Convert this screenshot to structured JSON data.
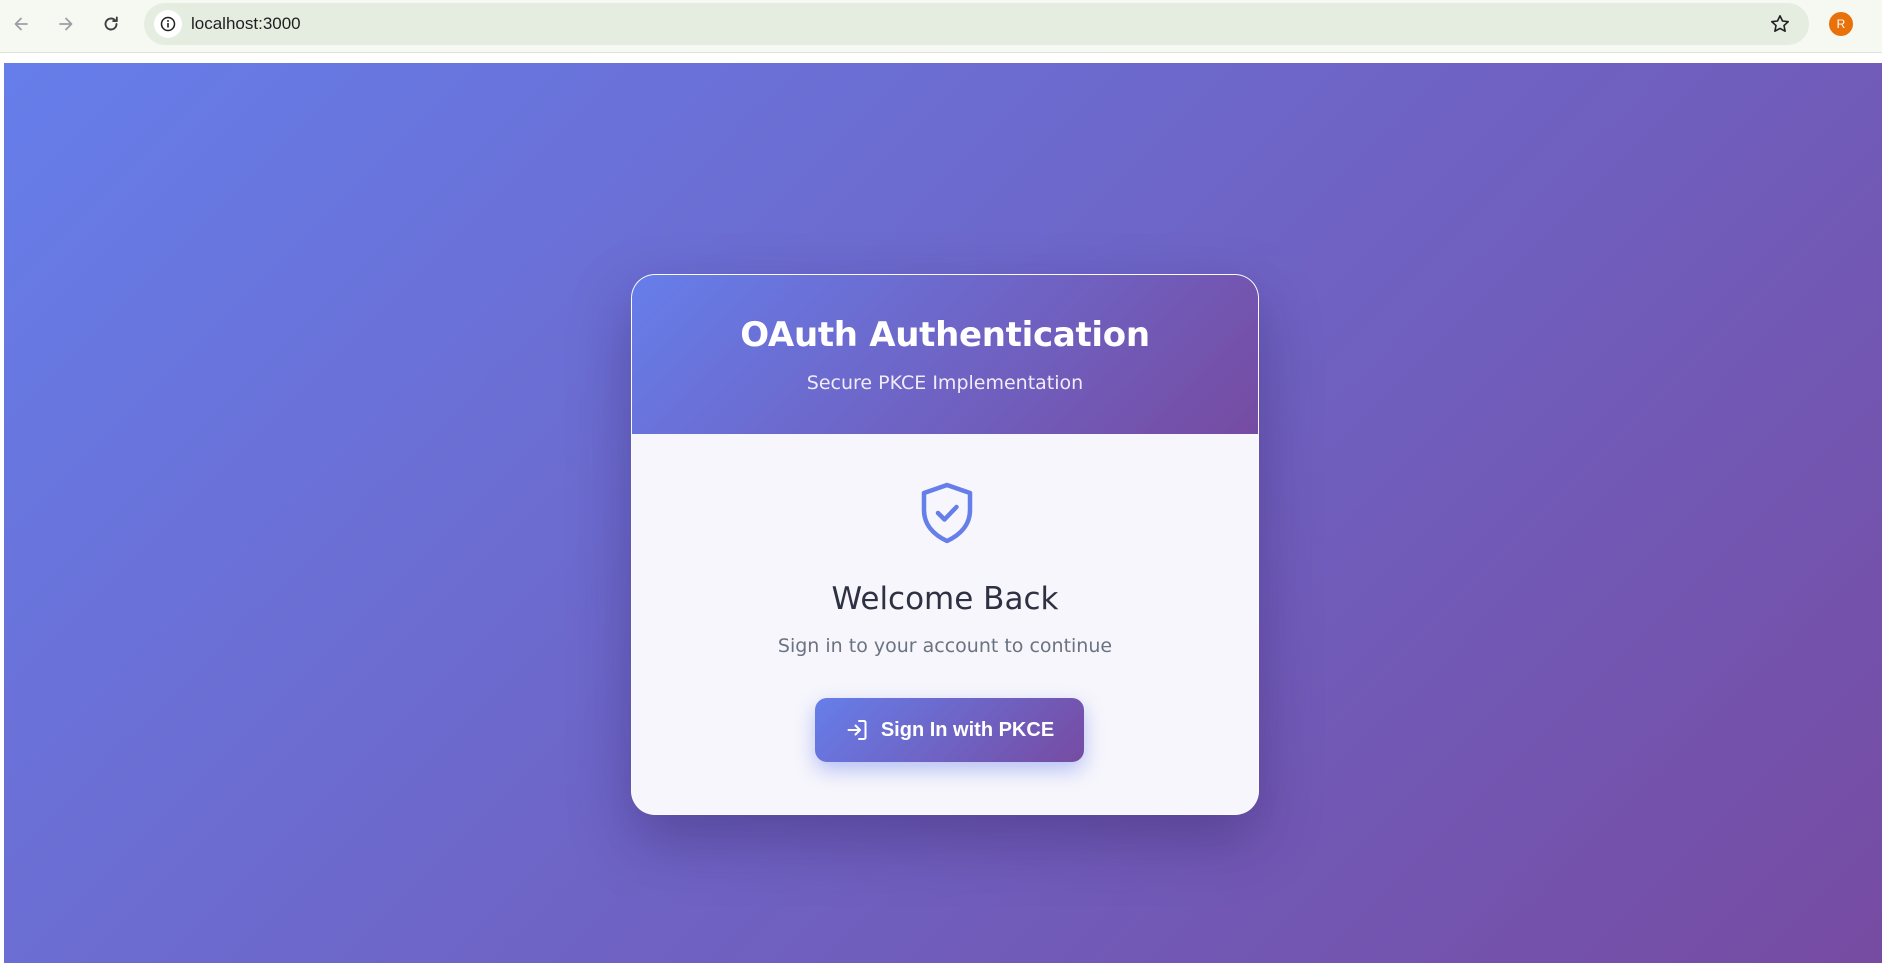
{
  "browser": {
    "url": "localhost:3000",
    "profile_initial": "R",
    "icons": [
      "back-arrow-icon",
      "forward-arrow-icon",
      "reload-icon",
      "site-info-icon",
      "bookmark-star-icon"
    ]
  },
  "header": {
    "title": "OAuth Authentication",
    "subtitle": "Secure PKCE Implementation"
  },
  "body": {
    "icon": "shield-check-icon",
    "heading": "Welcome Back",
    "description": "Sign in to your account to continue",
    "button_label": "Sign In with PKCE",
    "button_icon": "sign-in-icon"
  },
  "colors": {
    "gradient_start": "#667eea",
    "gradient_end": "#764ba2",
    "card_background": "#f7f6fc",
    "heading_text": "#2d3142",
    "muted_text": "#6b7280"
  }
}
